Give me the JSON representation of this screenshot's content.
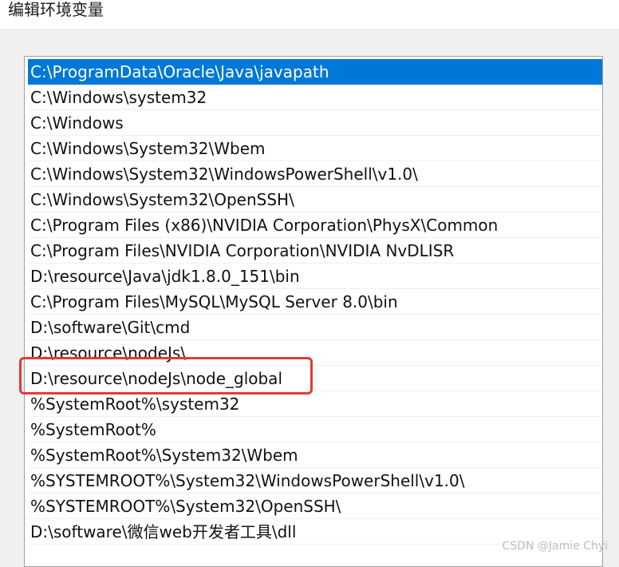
{
  "window": {
    "title": "编辑环境变量"
  },
  "path_list": {
    "selected_index": 0,
    "items": [
      "C:\\ProgramData\\Oracle\\Java\\javapath",
      "C:\\Windows\\system32",
      "C:\\Windows",
      "C:\\Windows\\System32\\Wbem",
      "C:\\Windows\\System32\\WindowsPowerShell\\v1.0\\",
      "C:\\Windows\\System32\\OpenSSH\\",
      "C:\\Program Files (x86)\\NVIDIA Corporation\\PhysX\\Common",
      "C:\\Program Files\\NVIDIA Corporation\\NVIDIA NvDLISR",
      "D:\\resource\\Java\\jdk1.8.0_151\\bin",
      "C:\\Program Files\\MySQL\\MySQL Server 8.0\\bin",
      "D:\\software\\Git\\cmd",
      "D:\\resource\\nodeJs\\",
      "D:\\resource\\nodeJs\\node_global",
      "%SystemRoot%\\system32",
      "%SystemRoot%",
      "%SystemRoot%\\System32\\Wbem",
      "%SYSTEMROOT%\\System32\\WindowsPowerShell\\v1.0\\",
      "%SYSTEMROOT%\\System32\\OpenSSH\\",
      "D:\\software\\微信web开发者工具\\dll"
    ]
  },
  "annotation": {
    "highlight_color": "#e53935",
    "highlighted_index": 12
  },
  "watermark": {
    "text": "CSDN @Jamie Chyi"
  },
  "colors": {
    "selection": "#0078d7",
    "selection_text": "#ffffff"
  }
}
